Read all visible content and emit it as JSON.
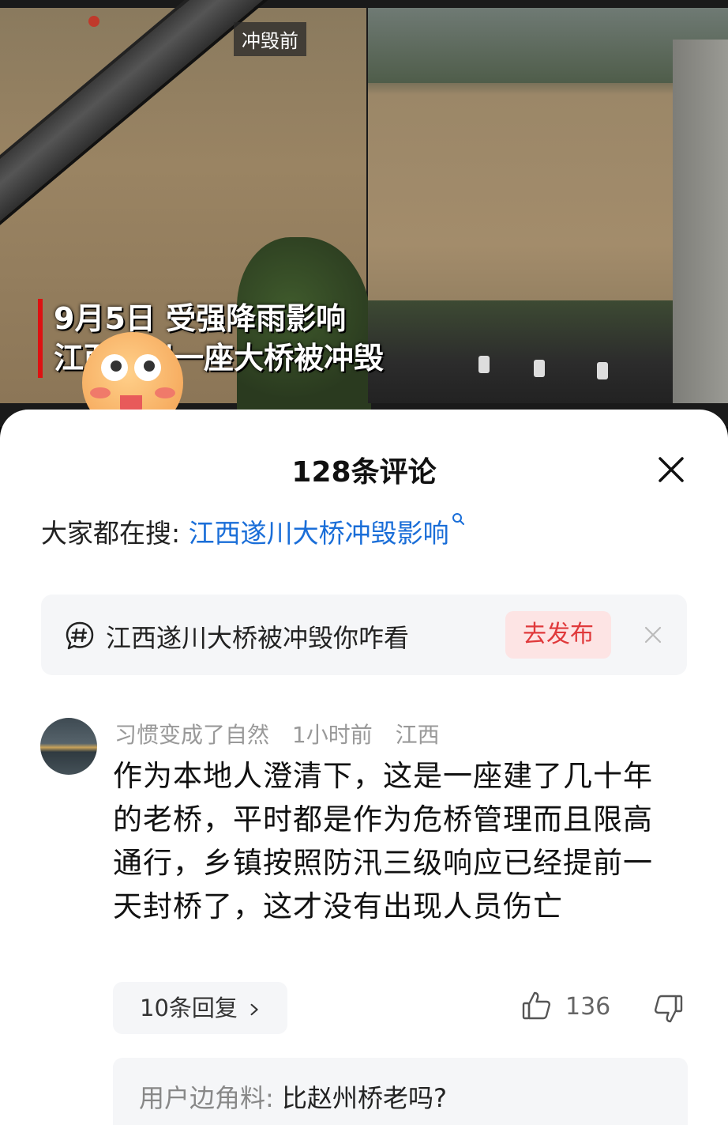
{
  "video": {
    "stage_tag": "冲毁前",
    "caption_line1": "9月5日 受强降雨影响",
    "caption_line2": "江西遂川一座大桥被冲毁"
  },
  "sheet": {
    "title": "128条评论",
    "hot_search_label": "大家都在搜:",
    "hot_search_term": "江西遂川大桥冲毁影响"
  },
  "prompt": {
    "text": "江西遂川大桥被冲毁你咋看",
    "publish_label": "去发布"
  },
  "comment": {
    "username": "习惯变成了自然",
    "time": "1小时前",
    "location": "江西",
    "text": "作为本地人澄清下，这是一座建了几十年的老桥，平时都是作为危桥管理而且限高通行，乡镇按照防汛三级响应已经提前一天封桥了，这才没有出现人员伤亡",
    "replies_label": "10条回复",
    "likes": "136"
  },
  "reply_preview": {
    "user": "用户边角料:",
    "text": "比赵州桥老吗?"
  },
  "colors": {
    "link": "#1a6ed8",
    "publish_bg": "#fde4e4",
    "publish_text": "#e0393b",
    "caption_bar": "#dd1111"
  }
}
